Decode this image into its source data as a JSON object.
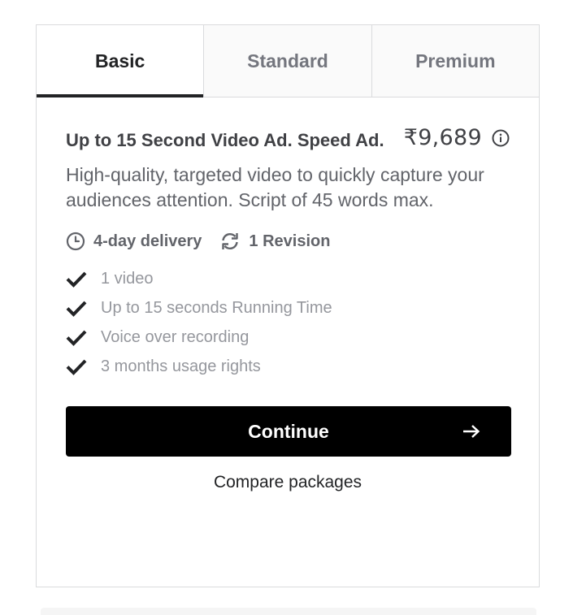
{
  "tabs": [
    {
      "label": "Basic",
      "active": true
    },
    {
      "label": "Standard",
      "active": false
    },
    {
      "label": "Premium",
      "active": false
    }
  ],
  "package": {
    "title": "Up to 15 Second Video Ad. Speed Ad.",
    "price": "₹9,689",
    "description": "High-quality, targeted video to quickly capture your audiences attention. Script of 45 words max.",
    "delivery": "4-day delivery",
    "revisions": "1 Revision",
    "features": [
      "1 video",
      "Up to 15 seconds Running Time",
      "Voice over recording",
      "3 months usage rights"
    ]
  },
  "actions": {
    "continue_label": "Continue",
    "compare_label": "Compare packages"
  },
  "colors": {
    "accent": "#000000",
    "tab_active_underline": "#222325",
    "muted_text": "#95979d",
    "border": "#dadbdd"
  },
  "icons": {
    "info": "info-icon",
    "delivery": "clock-icon",
    "revision": "refresh-icon",
    "check": "check-icon",
    "arrow": "arrow-right-icon"
  }
}
